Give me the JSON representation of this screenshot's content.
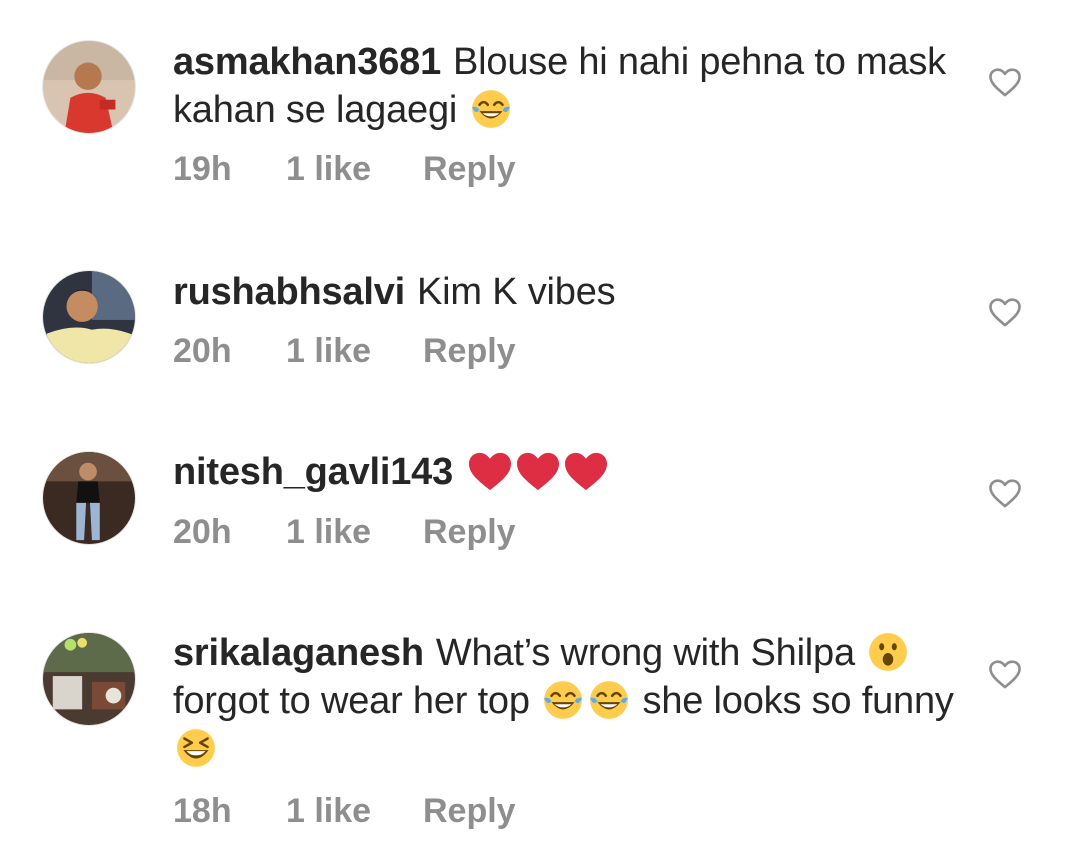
{
  "comments": [
    {
      "username": "asmakhan3681",
      "text_parts": [
        "Blouse hi nahi pehna to mask kahan se lagaegi"
      ],
      "emojis": [
        "face-with-tears-of-joy"
      ],
      "time": "19h",
      "likes": "1 like",
      "reply": "Reply"
    },
    {
      "username": "rushabhsalvi",
      "text_parts": [
        "Kim K vibes"
      ],
      "time": "20h",
      "likes": "1 like",
      "reply": "Reply"
    },
    {
      "username": "nitesh_gavli143",
      "text_parts": [],
      "emojis": [
        "red-heart",
        "red-heart",
        "red-heart"
      ],
      "time": "20h",
      "likes": "1 like",
      "reply": "Reply"
    },
    {
      "username": "srikalaganesh",
      "text_parts": [
        "What’s wrong with Shilpa",
        "forgot to wear her top",
        "she looks so funny"
      ],
      "emojis": [
        "face-with-open-mouth",
        "face-with-tears-of-joy",
        "face-with-tears-of-joy",
        "grinning-squinting-face"
      ],
      "time": "18h",
      "likes": "1 like",
      "reply": "Reply"
    }
  ],
  "colors": {
    "text": "#262626",
    "meta": "#8e8e8e",
    "heart_emoji": "#dd2e44",
    "emoji_yellow": "#ffcc4d"
  },
  "icons": {
    "like_button": "heart-outline-icon"
  }
}
